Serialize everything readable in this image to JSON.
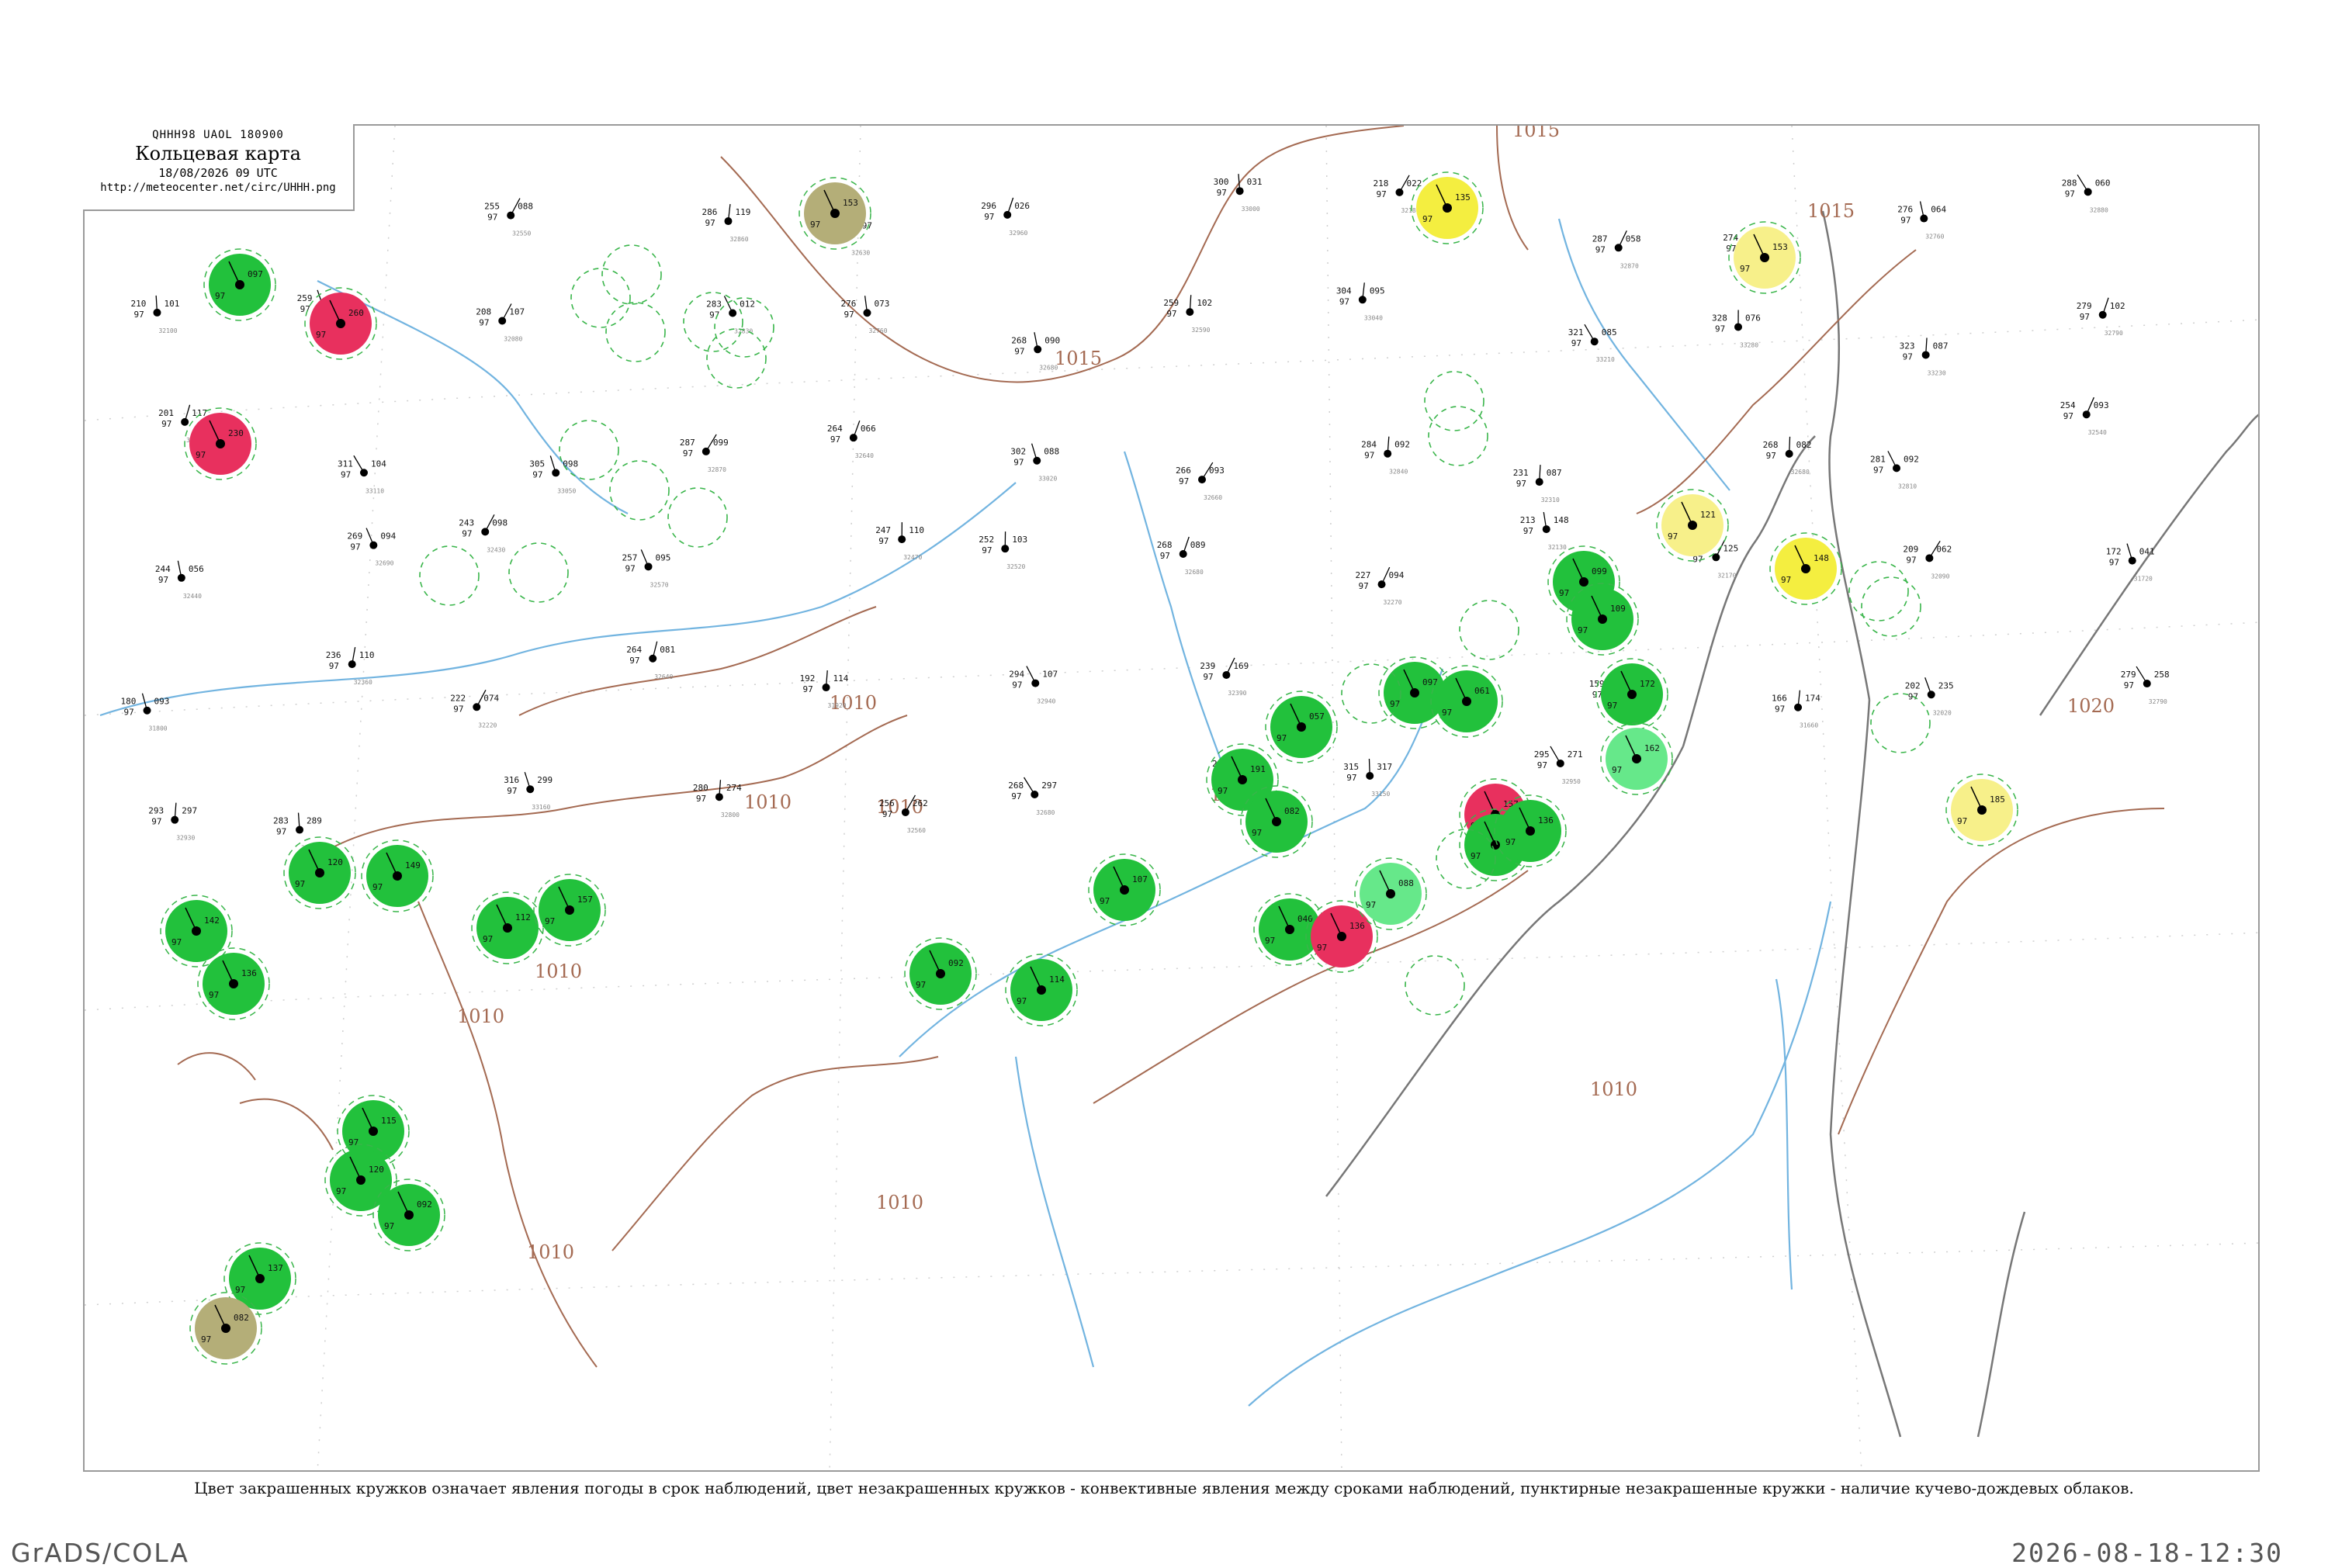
{
  "header": {
    "code": "QHHH98  UAOL  180900",
    "title": "Кольцевая карта",
    "date": "18/08/2026 09 UTC",
    "url": "http://meteocenter.net/circ/UHHH.png"
  },
  "caption": "Цвет закрашенных кружков означает явления погоды в срок наблюдений, цвет незакрашенных кружков - конвективные явления между сроками наблюдений, пунктирные незакрашенные кружки - наличие кучево-дождевых облаков.",
  "footer": {
    "left": "GrADS/COLA",
    "right": "2026-08-18-12:30"
  },
  "colors": {
    "rain": "#22c13c",
    "shower": "#66e88a",
    "thunder": "#e8305e",
    "fog": "#b4ae78",
    "haze": "#f4ee40",
    "pale_haze": "#f7f08a",
    "convective_ring": "#39b54a",
    "isobar": "#a46a52",
    "water": "#72b4e0"
  },
  "isobar_labels": [
    "1015",
    "1015",
    "1015",
    "1010",
    "1010",
    "1010",
    "1010",
    "1010",
    "1010",
    "1010",
    "1010",
    "1010",
    "1020"
  ],
  "weather_circles": [
    {
      "type": "rain",
      "num": "097"
    },
    {
      "type": "thunder",
      "num": "260"
    },
    {
      "type": "thunder",
      "num": "230"
    },
    {
      "type": "rain",
      "num": "120"
    },
    {
      "type": "rain",
      "num": "142"
    },
    {
      "type": "rain",
      "num": "136"
    },
    {
      "type": "rain",
      "num": "115"
    },
    {
      "type": "rain",
      "num": "120"
    },
    {
      "type": "rain",
      "num": "092"
    },
    {
      "type": "rain",
      "num": "137"
    },
    {
      "type": "rain",
      "num": "149"
    },
    {
      "type": "rain",
      "num": "112"
    },
    {
      "type": "rain",
      "num": "157"
    },
    {
      "type": "rain",
      "num": "092"
    },
    {
      "type": "rain",
      "num": "114"
    },
    {
      "type": "rain",
      "num": "107"
    },
    {
      "type": "rain",
      "num": "057"
    },
    {
      "type": "rain",
      "num": "191"
    },
    {
      "type": "rain",
      "num": "082"
    },
    {
      "type": "rain",
      "num": "040"
    },
    {
      "type": "thunder",
      "num": "136"
    },
    {
      "type": "shower",
      "num": "088"
    },
    {
      "type": "rain",
      "num": "097"
    },
    {
      "type": "rain",
      "num": "061"
    },
    {
      "type": "thunder",
      "num": "157"
    },
    {
      "type": "rain",
      "num": "046"
    },
    {
      "type": "rain",
      "num": "136"
    },
    {
      "type": "rain",
      "num": "099"
    },
    {
      "type": "rain",
      "num": "109"
    },
    {
      "type": "rain",
      "num": "172"
    },
    {
      "type": "shower",
      "num": "162"
    },
    {
      "type": "haze",
      "num": "135"
    },
    {
      "type": "haze",
      "num": "148"
    },
    {
      "type": "pale_haze",
      "num": "153"
    },
    {
      "type": "pale_haze",
      "num": "121"
    },
    {
      "type": "pale_haze",
      "num": "185"
    },
    {
      "type": "fog",
      "num": "153"
    },
    {
      "type": "fog",
      "num": "082"
    }
  ],
  "station_numbers": [
    "213",
    "067",
    "298",
    "062",
    "255",
    "088",
    "286",
    "119",
    "263",
    "097",
    "296",
    "026",
    "300",
    "031",
    "218",
    "022",
    "287",
    "058",
    "274",
    "085",
    "276",
    "064",
    "288",
    "060",
    "210",
    "101",
    "259",
    "090",
    "208",
    "107",
    "283",
    "012",
    "276",
    "073",
    "268",
    "090",
    "259",
    "102",
    "304",
    "095",
    "321",
    "085",
    "328",
    "076",
    "323",
    "087",
    "279",
    "102",
    "201",
    "117",
    "311",
    "104",
    "305",
    "098",
    "287",
    "099",
    "264",
    "066",
    "302",
    "088",
    "266",
    "093",
    "284",
    "092",
    "231",
    "087",
    "268",
    "082",
    "281",
    "092",
    "254",
    "093",
    "244",
    "056",
    "269",
    "094",
    "243",
    "098",
    "257",
    "095",
    "247",
    "110",
    "252",
    "103",
    "268",
    "089",
    "227",
    "094",
    "213",
    "148",
    "217",
    "125",
    "209",
    "062",
    "172",
    "041",
    "180",
    "093",
    "236",
    "110",
    "222",
    "074",
    "264",
    "081",
    "192",
    "114",
    "294",
    "107",
    "239",
    "169",
    "176",
    "112",
    "159",
    "138",
    "166",
    "174",
    "202",
    "235",
    "279",
    "258",
    "293",
    "297",
    "283",
    "289",
    "316",
    "299",
    "280",
    "274",
    "256",
    "262",
    "268",
    "297",
    "290",
    "301",
    "315",
    "317",
    "295",
    "271"
  ]
}
